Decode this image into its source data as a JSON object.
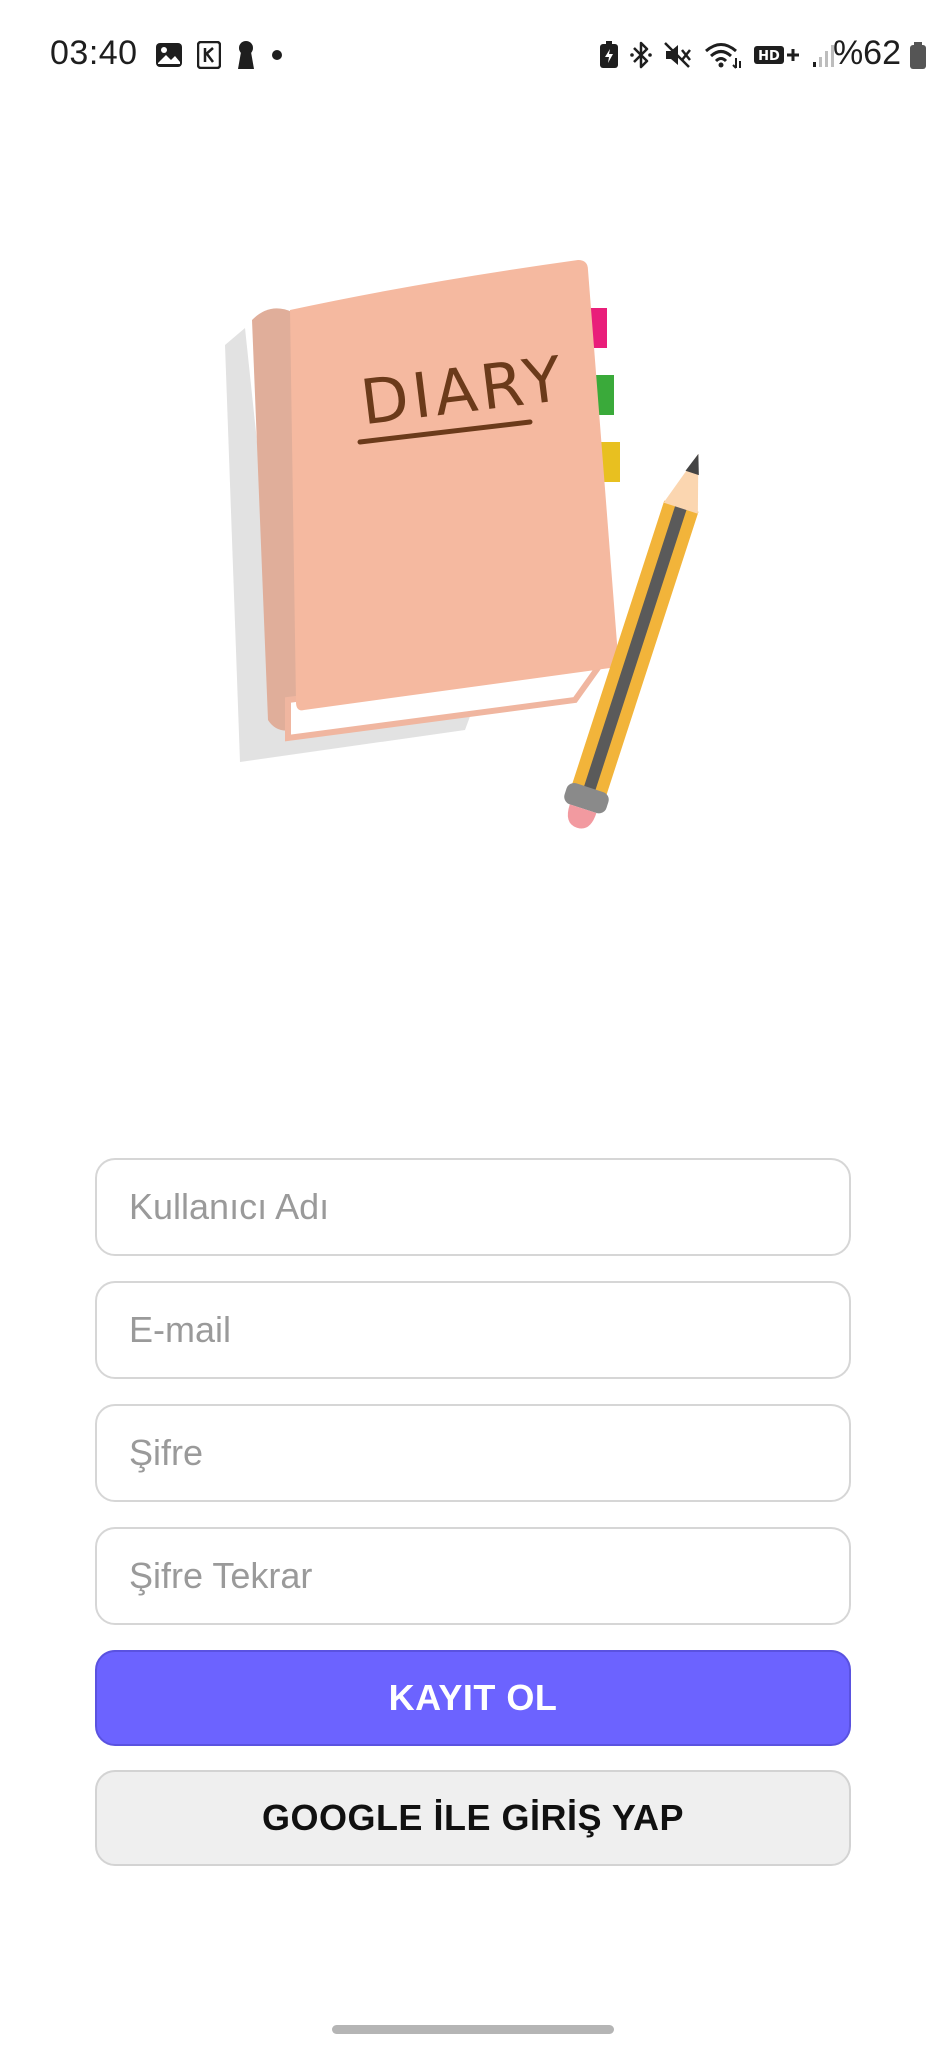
{
  "status_bar": {
    "time": "03:40",
    "battery_text": "%62",
    "left_icons": [
      "image-icon",
      "k-app-icon",
      "keyhole-icon",
      "dot-icon"
    ],
    "right_icons": [
      "battery-saver-icon",
      "bluetooth-icon",
      "mute-icon",
      "wifi-icon",
      "hd-plus-icon",
      "signal-icon"
    ]
  },
  "illustration": {
    "cover_text": "DIARY",
    "icon": "diary-book-with-pencil"
  },
  "form": {
    "username_placeholder": "Kullanıcı Adı",
    "email_placeholder": "E-mail",
    "password_placeholder": "Şifre",
    "password_repeat_placeholder": "Şifre Tekrar"
  },
  "buttons": {
    "register_label": "KAYIT OL",
    "google_label": "GOOGLE İLE GİRİŞ YAP"
  },
  "colors": {
    "accent": "#6c63ff",
    "book_cover": "#f5b9a0",
    "secondary_button": "#efefef"
  }
}
